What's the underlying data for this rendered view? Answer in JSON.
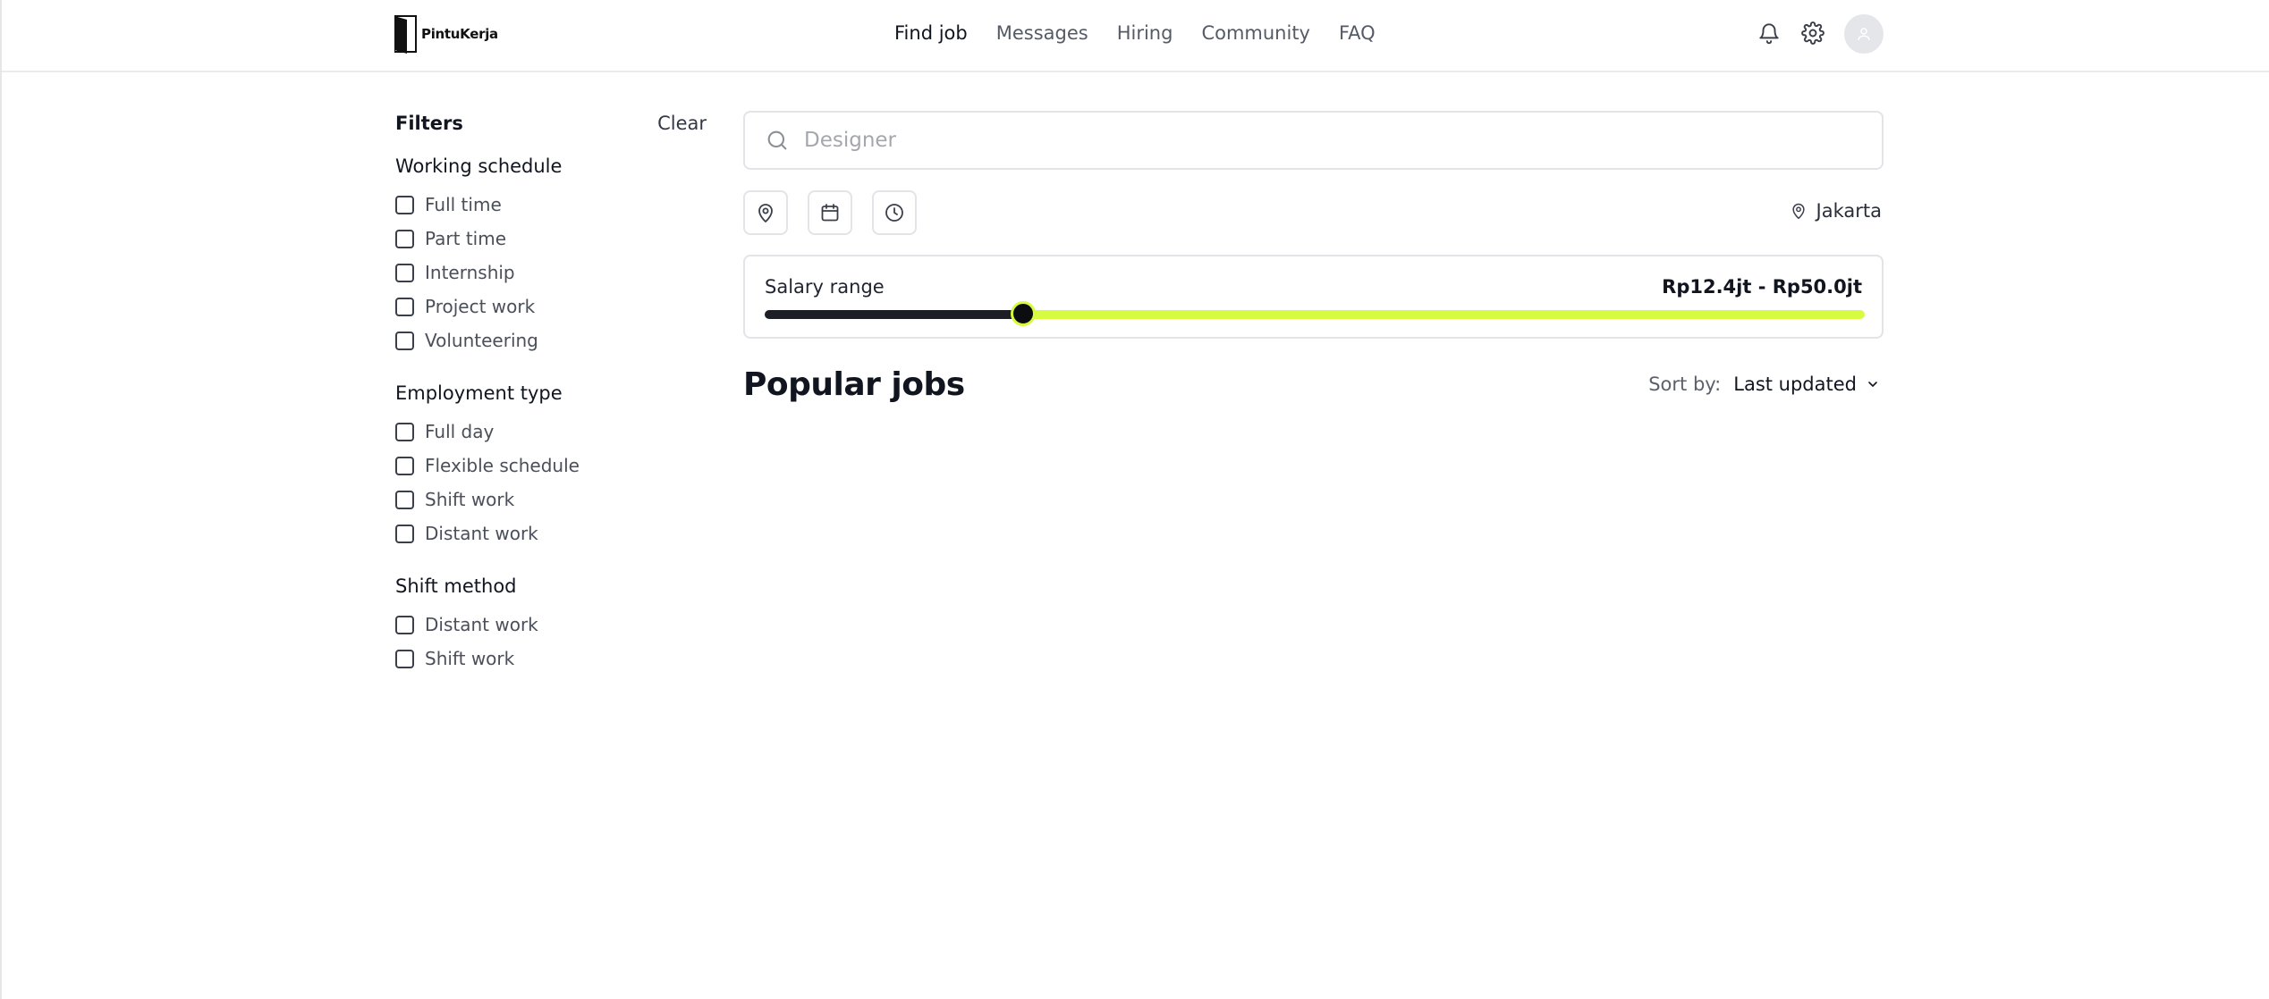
{
  "app": {
    "logo_text": "PintuKerja"
  },
  "nav": {
    "items": [
      {
        "label": "Find job",
        "active": true
      },
      {
        "label": "Messages",
        "active": false
      },
      {
        "label": "Hiring",
        "active": false
      },
      {
        "label": "Community",
        "active": false
      },
      {
        "label": "FAQ",
        "active": false
      }
    ]
  },
  "header_icons": [
    "bell-icon",
    "gear-icon",
    "user-avatar-icon"
  ],
  "filters": {
    "title": "Filters",
    "clear_label": "Clear",
    "groups": [
      {
        "title": "Working schedule",
        "options": [
          "Full time",
          "Part time",
          "Internship",
          "Project work",
          "Volunteering"
        ]
      },
      {
        "title": "Employment type",
        "options": [
          "Full day",
          "Flexible schedule",
          "Shift work",
          "Distant work"
        ]
      },
      {
        "title": "Shift method",
        "options": [
          "Distant work",
          "Shift work"
        ]
      }
    ]
  },
  "search": {
    "placeholder": "Designer",
    "value": ""
  },
  "quick_filters": [
    "map-pin-icon",
    "calendar-icon",
    "clock-icon"
  ],
  "location": {
    "label": "Jakarta"
  },
  "salary": {
    "label": "Salary range",
    "value_text": "Rp12.4jt - Rp50.0jt",
    "min_fraction": 0.235
  },
  "jobs": {
    "title": "Popular jobs",
    "sort_label": "Sort by:",
    "sort_value": "Last updated"
  },
  "colors": {
    "accent": "#d7fb3f",
    "text": "#111520",
    "muted": "#555b66"
  }
}
